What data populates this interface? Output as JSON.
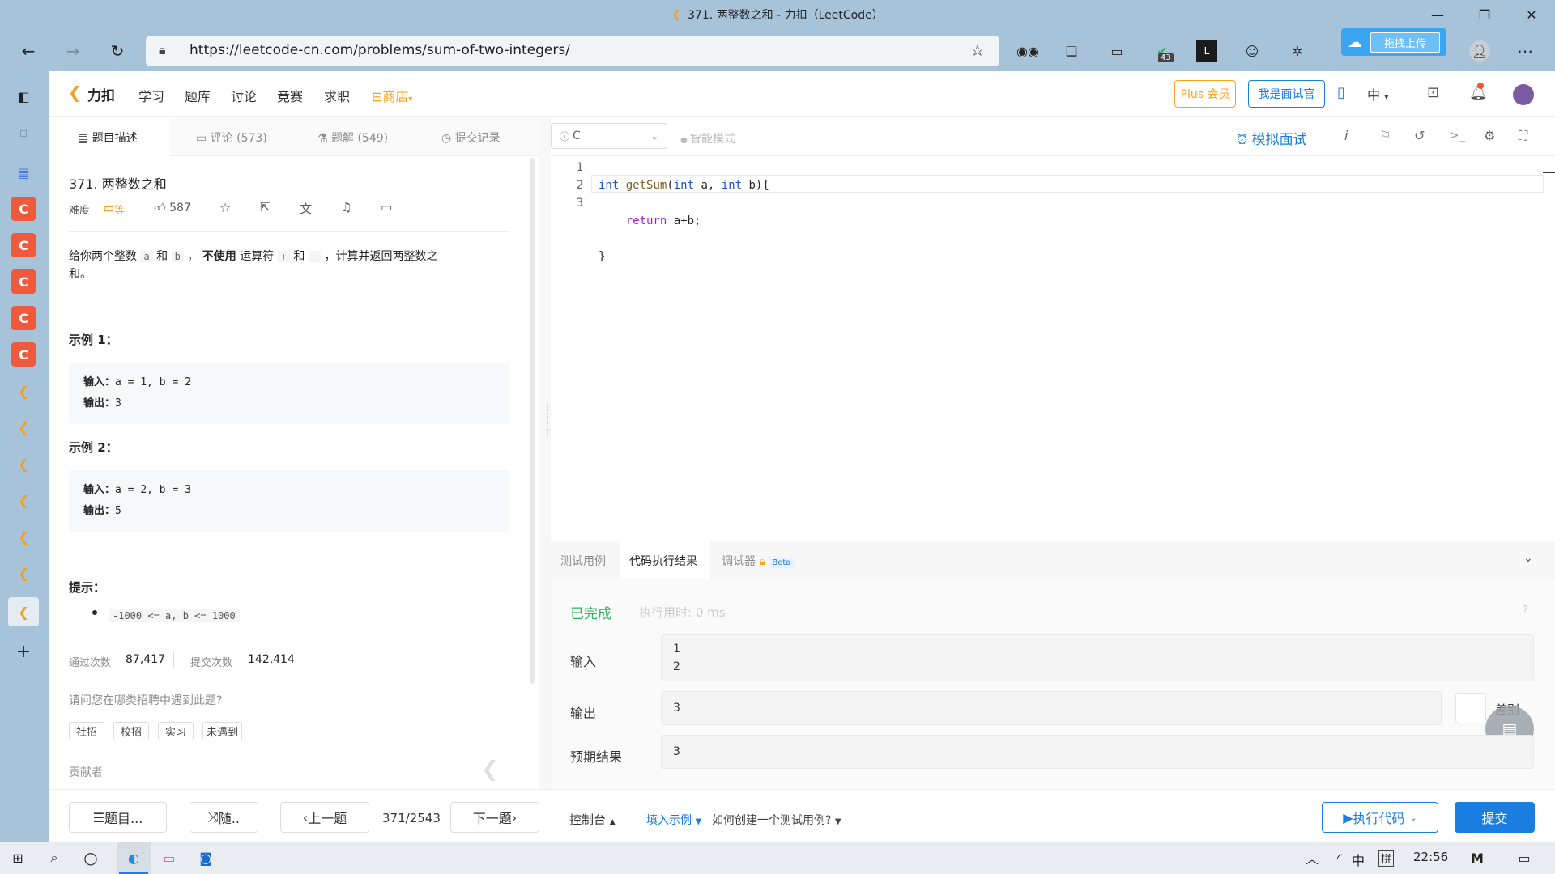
{
  "browser": {
    "tab_title": "371. 两整数之和 - 力扣（LeetCode）",
    "url": "https://leetcode-cn.com/problems/sum-of-two-integers/",
    "ext_badge": "43",
    "upload_label": "拖拽上传"
  },
  "header": {
    "logo": "力扣",
    "nav": [
      "学习",
      "题库",
      "讨论",
      "竞赛",
      "求职"
    ],
    "store": "商店",
    "plus": "Plus 会员",
    "interviewer": "我是面试官",
    "lang": "中"
  },
  "left_tabs": {
    "description": "题目描述",
    "comments": "评论 (573)",
    "solutions": "题解 (549)",
    "submissions": "提交记录"
  },
  "problem": {
    "title": "371. 两整数之和",
    "difficulty_label": "难度",
    "difficulty": "中等",
    "likes": "587",
    "desc_part1": "给你两个整数",
    "var_a": "a",
    "and1": "和",
    "var_b": "b",
    "desc_part2": "，",
    "bold": "不使用",
    "desc_part3": "运算符",
    "plus": "+",
    "and2": "和",
    "minus": "-",
    "desc_part4": "，计算并返回两整数之",
    "desc_part5": "和。",
    "example1_title": "示例 1：",
    "example1_in_label": "输入：",
    "example1_in": "a = 1, b = 2",
    "example1_out_label": "输出：",
    "example1_out": "3",
    "example2_title": "示例 2：",
    "example2_in_label": "输入：",
    "example2_in": "a = 2, b = 3",
    "example2_out_label": "输出：",
    "example2_out": "5",
    "hint_title": "提示：",
    "hint": "-1000 <= a, b <= 1000",
    "accepted_label": "通过次数",
    "accepted": "87,417",
    "submitted_label": "提交次数",
    "submitted": "142,414",
    "interview_q": "请问您在哪类招聘中遇到此题?",
    "tags": [
      "社招",
      "校招",
      "实习",
      "未遇到"
    ],
    "contributors": "贡献者"
  },
  "editor": {
    "language": "C",
    "smart_mode": "智能模式",
    "mock_interview": "模拟面试",
    "lines": [
      "1",
      "2",
      "3"
    ],
    "code_l1_kw1": "int",
    "code_l1_fn": "getSum",
    "code_l1_p1": "(",
    "code_l1_kw2": "int",
    "code_l1_p2": " a, ",
    "code_l1_kw3": "int",
    "code_l1_p3": " b){",
    "code_l2_kw": "return",
    "code_l2_rest": " a+b;",
    "code_l3": "}"
  },
  "console": {
    "tabs": [
      "测试用例",
      "代码执行结果",
      "调试器"
    ],
    "beta": "Beta",
    "status": "已完成",
    "runtime": "执行用时: 0 ms",
    "input_label": "输入",
    "input_lines": [
      "1",
      "2"
    ],
    "output_label": "输出",
    "output": "3",
    "diff": "差别",
    "expected_label": "预期结果",
    "expected": "3"
  },
  "bottom": {
    "list": "题目...",
    "random": "随..",
    "prev": "上一题",
    "counter": "371/2543",
    "next": "下一题",
    "console": "控制台",
    "fill_example": "填入示例",
    "how_to": "如何创建一个测试用例?",
    "run": "执行代码",
    "submit": "提交"
  },
  "taskbar": {
    "time": "22:56",
    "ime": "中",
    "ime2": "拼"
  },
  "colors": {
    "accent_orange": "#ffa116",
    "accent_blue": "#1a7de0",
    "success_green": "#2db55d",
    "chrome": "#a7c3da"
  }
}
